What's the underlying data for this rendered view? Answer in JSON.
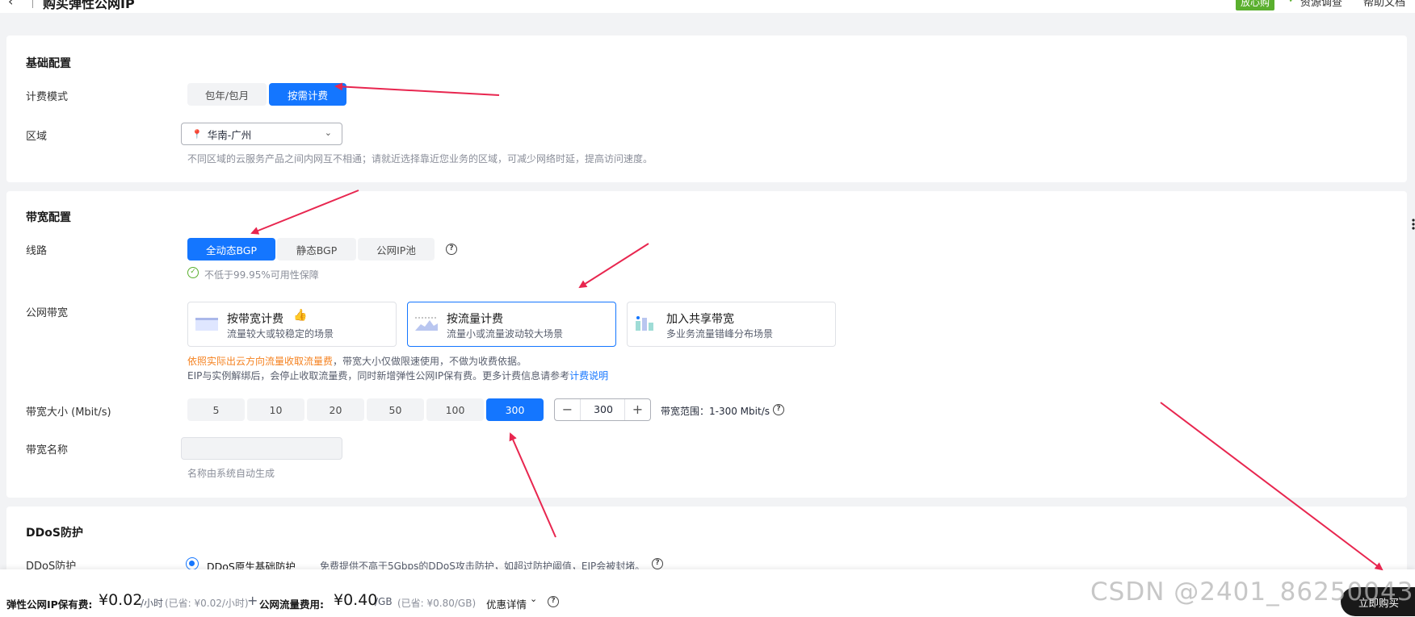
{
  "header": {
    "title": "购买弹性公网IP",
    "badge": "放心购",
    "link1": "资源调查",
    "link2": "帮助文档"
  },
  "basic": {
    "title": "基础配置",
    "billing_label": "计费模式",
    "billing_options": [
      "包年/包月",
      "按需计费"
    ],
    "billing_selected": "按需计费",
    "region_label": "区域",
    "region_value": "华南-广州",
    "region_hint": "不同区域的云服务产品之间内网互不相通；请就近选择靠近您业务的区域，可减少网络时延，提高访问速度。"
  },
  "bandwidth": {
    "title": "带宽配置",
    "line_label": "线路",
    "line_options": [
      "全动态BGP",
      "静态BGP",
      "公网IP池"
    ],
    "line_selected": "全动态BGP",
    "line_hint": "不低于99.95%可用性保障",
    "public_bw_label": "公网带宽",
    "cards": [
      {
        "title": "按带宽计费",
        "desc": "流量较大或较稳定的场景"
      },
      {
        "title": "按流量计费",
        "desc": "流量小或流量波动较大场景"
      },
      {
        "title": "加入共享带宽",
        "desc": "多业务流量错峰分布场景"
      }
    ],
    "card_selected": "按流量计费",
    "note_highlight": "依照实际出云方向流量收取流量费",
    "note_rest": "，带宽大小仅做限速使用，不做为收费依据。",
    "note2": "EIP与实例解绑后，会停止收取流量费，同时新增弹性公网IP保有费。更多计费信息请参考",
    "note2_link": "计费说明",
    "size_label": "带宽大小 (Mbit/s)",
    "size_options": [
      "5",
      "10",
      "20",
      "50",
      "100",
      "300"
    ],
    "size_selected": "300",
    "stepper_value": "300",
    "size_range": "带宽范围：1-300 Mbit/s",
    "name_label": "带宽名称",
    "name_hint": "名称由系统自动生成"
  },
  "ddos": {
    "title": "DDoS防护",
    "label": "DDoS防护",
    "option": "DDoS原生基础防护",
    "desc": "免费提供不高于5Gbps的DDoS攻击防护，如超过防护阈值，EIP会被封堵。"
  },
  "footer": {
    "ip_fee_label": "弹性公网IP保有费:",
    "ip_fee_price": "¥0.02",
    "ip_fee_unit": "/小时",
    "ip_fee_save": "(已省: ¥0.02/小时)",
    "plus": "+",
    "traffic_label": "公网流量费用:",
    "traffic_price": "¥0.40",
    "traffic_unit": "/GB",
    "traffic_save": "(已省: ¥0.80/GB)",
    "discount": "优惠详情",
    "buy": "立即购买"
  },
  "watermark": "CSDN @2401_86250043",
  "colors": {
    "accent": "#1476ff",
    "arrow": "#e8264f",
    "warning": "#f58220"
  }
}
